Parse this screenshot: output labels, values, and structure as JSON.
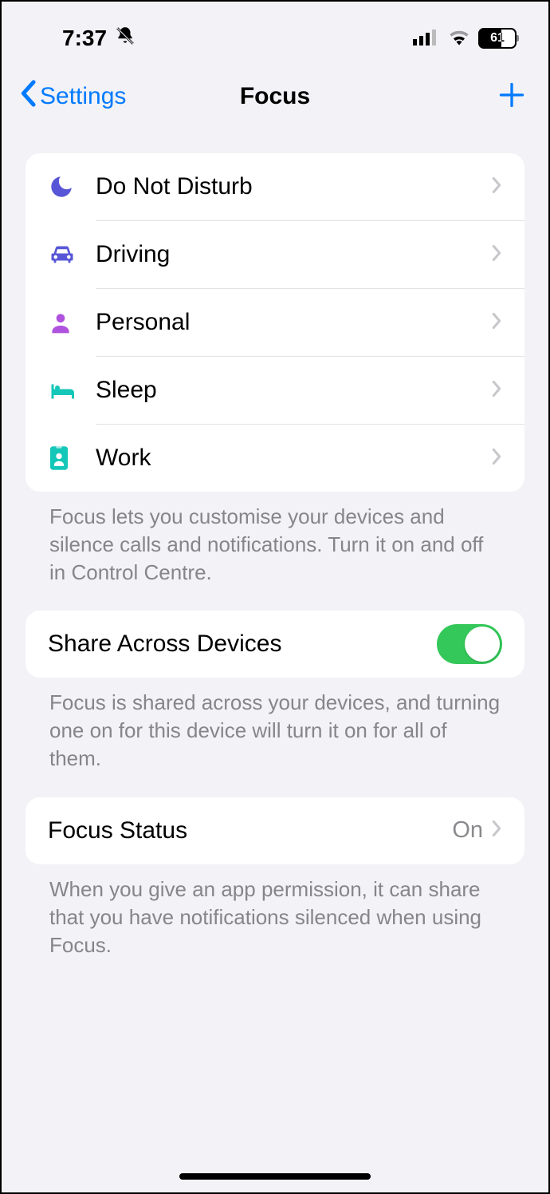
{
  "status": {
    "time": "7:37",
    "battery": "61"
  },
  "nav": {
    "back": "Settings",
    "title": "Focus"
  },
  "focus_modes": [
    {
      "icon": "moon",
      "color": "#5856d6",
      "label": "Do Not Disturb"
    },
    {
      "icon": "car",
      "color": "#5856d6",
      "label": "Driving"
    },
    {
      "icon": "person",
      "color": "#af52de",
      "label": "Personal"
    },
    {
      "icon": "bed",
      "color": "#14c7b8",
      "label": "Sleep"
    },
    {
      "icon": "badge",
      "color": "#14c7b8",
      "label": "Work"
    }
  ],
  "footers": {
    "modes": "Focus lets you customise your devices and silence calls and notifications. Turn it on and off in Control Centre.",
    "share": "Focus is shared across your devices, and turning one on for this device will turn it on for all of them.",
    "status": "When you give an app permission, it can share that you have notifications silenced when using Focus."
  },
  "share": {
    "label": "Share Across Devices",
    "on": true
  },
  "focus_status": {
    "label": "Focus Status",
    "value": "On"
  }
}
